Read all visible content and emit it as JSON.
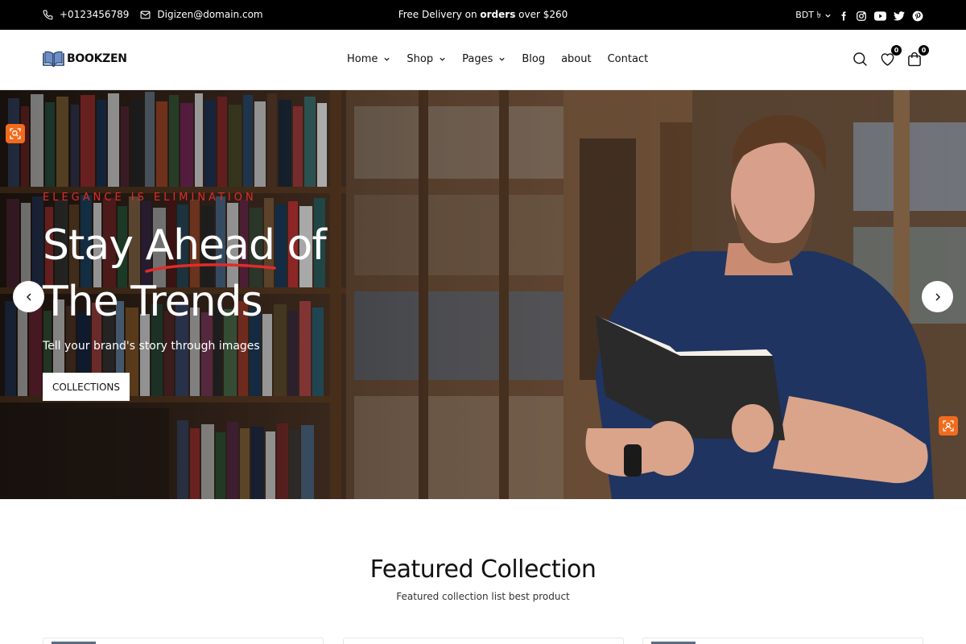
{
  "topbar": {
    "phone": "+0123456789",
    "email": "Digizen@domain.com",
    "promo_prefix": "Free Delivery on ",
    "promo_bold": "orders",
    "promo_suffix": " over $260",
    "currency": "BDT ৳",
    "socials": [
      "facebook-icon",
      "instagram-icon",
      "youtube-icon",
      "twitter-icon",
      "pinterest-icon"
    ]
  },
  "header": {
    "logo_text": "BOOKZEN",
    "nav": [
      {
        "label": "Home",
        "dropdown": true
      },
      {
        "label": "Shop",
        "dropdown": true
      },
      {
        "label": "Pages",
        "dropdown": true
      },
      {
        "label": "Blog",
        "dropdown": false
      },
      {
        "label": "about",
        "dropdown": false
      },
      {
        "label": "Contact",
        "dropdown": false
      }
    ],
    "wishlist_count": "0",
    "cart_count": "0"
  },
  "hero": {
    "eyebrow": "ELEGANCE IS ELIMINATION",
    "title_part1": "Stay ",
    "title_highlight": "Ahead",
    "title_part2": " of",
    "title_line2": "The Trends",
    "subtitle": "Tell your brand's story through images",
    "cta_label": "COLLECTIONS"
  },
  "featured": {
    "title": "Featured Collection",
    "subtitle": "Featured collection list best product"
  },
  "colors": {
    "accent_red": "#e12b2b",
    "topbar_bg": "#000000",
    "floating_orange": "#f26b1d"
  }
}
